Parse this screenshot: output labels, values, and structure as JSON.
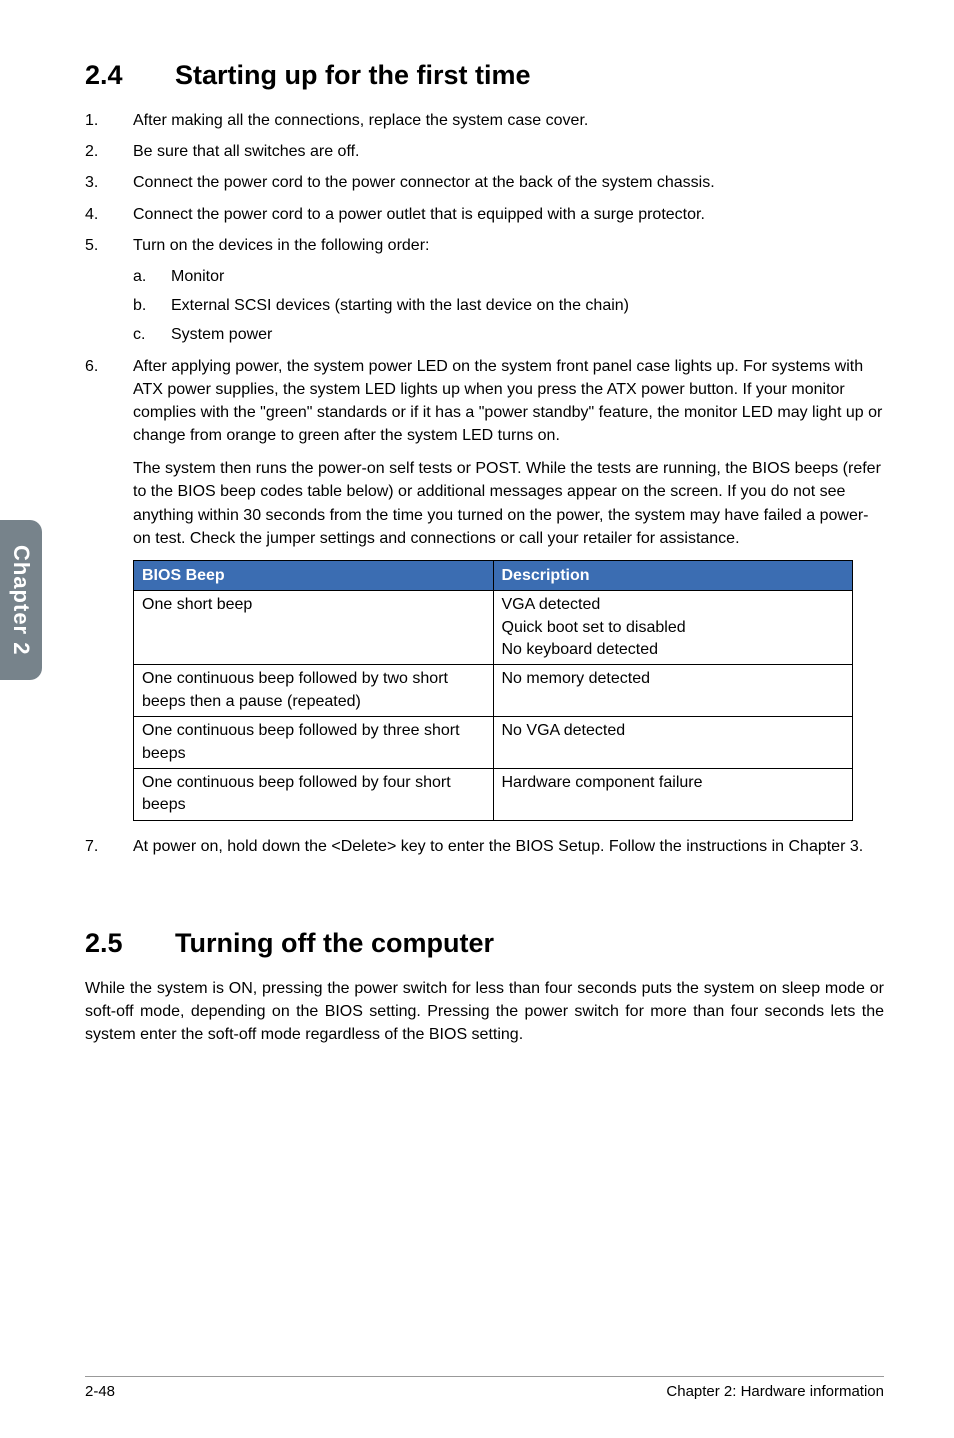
{
  "sideTab": "Chapter 2",
  "sec24": {
    "num": "2.4",
    "title": "Starting up for the first time",
    "steps": [
      "After making all the connections, replace the system case cover.",
      "Be sure that all switches are off.",
      "Connect the power cord to the power connector at the back of the system chassis.",
      "Connect the power cord to a power outlet that is equipped with a surge protector.",
      "Turn on the devices in the following order:"
    ],
    "sub5": [
      {
        "letter": "a.",
        "text": "Monitor"
      },
      {
        "letter": "b.",
        "text": "External SCSI devices (starting with the last device on the chain)"
      },
      {
        "letter": "c.",
        "text": "System power"
      }
    ],
    "step6": "After applying power, the system power LED on the system front panel case lights up. For systems with ATX power supplies, the system LED lights up when you press the ATX power button. If your monitor complies with the \"green\" standards or if it has a \"power standby\" feature, the monitor LED may light up or change from orange to green after the system LED turns on.",
    "step6b": "The system then runs the power-on self tests or POST. While the tests are running, the BIOS beeps (refer to the BIOS beep codes table below) or additional messages appear on the screen. If you do not see anything within 30 seconds from the time you turned on the power, the system may have failed a power-on test. Check the jumper settings and connections or call your retailer for assistance.",
    "step7": "At power on, hold down the <Delete> key to enter the BIOS Setup. Follow the instructions in Chapter 3."
  },
  "biosTable": {
    "headers": [
      "BIOS Beep",
      "Description"
    ],
    "rows": [
      {
        "beep": "One short beep",
        "desc": "VGA detected\nQuick boot set to disabled\nNo keyboard detected"
      },
      {
        "beep": "One continuous beep followed by two short beeps then a pause (repeated)",
        "desc": "No memory detected"
      },
      {
        "beep": "One continuous beep followed by three short beeps",
        "desc": "No VGA detected"
      },
      {
        "beep": "One continuous beep followed by four short beeps",
        "desc": "Hardware component failure"
      }
    ]
  },
  "sec25": {
    "num": "2.5",
    "title": "Turning off the computer",
    "para": "While the system is ON, pressing the power switch for less than four seconds puts the system on sleep mode or soft-off mode, depending on the BIOS setting. Pressing the power switch for more than four seconds lets the system enter the soft-off mode regardless of the BIOS setting."
  },
  "footer": {
    "pageNum": "2-48",
    "chapter": "Chapter 2: Hardware information"
  }
}
